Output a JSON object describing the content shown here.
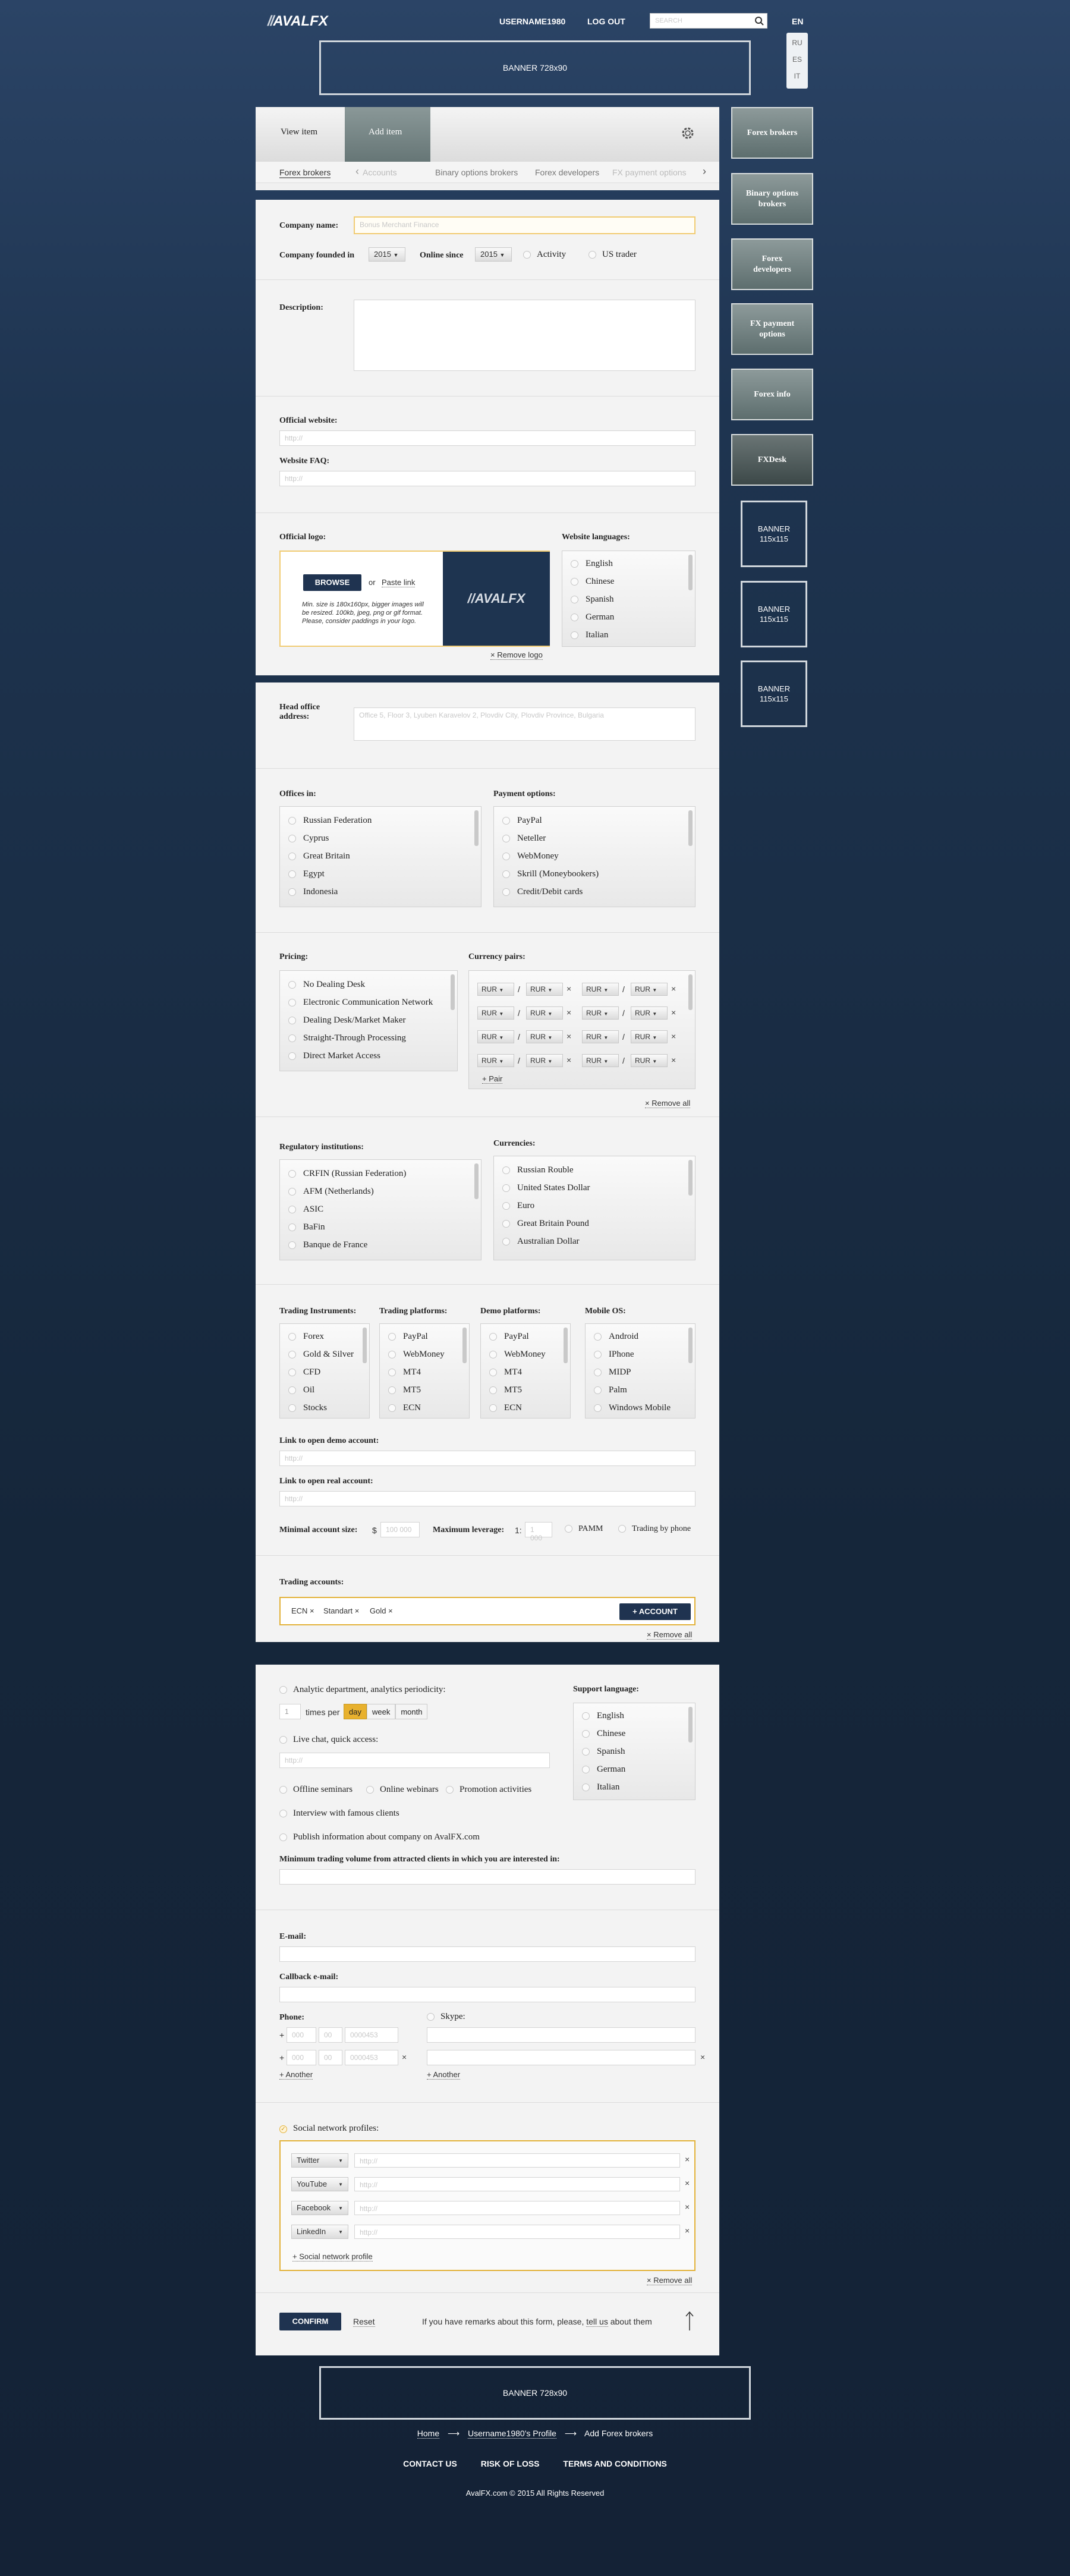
{
  "header": {
    "logo": "AVALFX",
    "username": "USERNAME1980",
    "logout": "LOG OUT",
    "search_placeholder": "SEARCH",
    "lang_current": "EN",
    "lang_options": [
      "RU",
      "ES",
      "IT"
    ]
  },
  "banner_top": "BANNER 728x90",
  "banner_bottom": "BANNER 728x90",
  "tabs": {
    "view": "View item",
    "add": "Add item"
  },
  "categories": [
    "Forex brokers",
    "Accounts",
    "Binary options brokers",
    "Forex developers",
    "FX payment options"
  ],
  "sidebar": {
    "items": [
      "Forex brokers",
      "Binary options brokers",
      "Forex developers",
      "FX payment options",
      "Forex info",
      "FXDesk"
    ],
    "banner": "BANNER 115x115"
  },
  "company": {
    "name_label": "Company name:",
    "name_value": "Bonus Merchant Finance",
    "founded_label": "Company founded in",
    "founded_value": "2015",
    "online_label": "Online since",
    "online_value": "2015",
    "activity": "Activity",
    "us_trader": "US trader"
  },
  "description_label": "Description:",
  "website": {
    "official_label": "Official website:",
    "official_placeholder": "http://",
    "faq_label": "Website FAQ:",
    "faq_placeholder": "http://"
  },
  "logo": {
    "label": "Official logo:",
    "browse": "BROWSE",
    "or": "or",
    "paste": "Paste link",
    "hint": "Min. size is 180x160px, bigger images will be resized. 100kb, jpeg, png or gif format. Please, consider paddings in your logo.",
    "preview": "AVALFX",
    "remove": "× Remove logo"
  },
  "website_languages": {
    "label": "Website languages:",
    "items": [
      "English",
      "Chinese",
      "Spanish",
      "German",
      "Italian"
    ]
  },
  "head_office": {
    "label": "Head office address:",
    "placeholder": "Office 5, Floor 3, Lyuben Karavelov 2, Plovdiv City, Plovdiv Province, Bulgaria"
  },
  "offices": {
    "label": "Offices in:",
    "items": [
      "Russian Federation",
      "Cyprus",
      "Great Britain",
      "Egypt",
      "Indonesia"
    ]
  },
  "payment": {
    "label": "Payment options:",
    "items": [
      "PayPal",
      "Neteller",
      "WebMoney",
      "Skrill (Moneybookers)",
      "Credit/Debit cards"
    ]
  },
  "pricing": {
    "label": "Pricing:",
    "items": [
      "No Dealing Desk",
      "Electronic Communication Network",
      "Dealing Desk/Market Maker",
      "Straight-Through Processing",
      "Direct Market Access"
    ]
  },
  "currency_pairs": {
    "label": "Currency pairs:",
    "value": "RUR",
    "slash": "/",
    "add": "+ Pair",
    "remove": "× Remove all"
  },
  "regulatory": {
    "label": "Regulatory institutions:",
    "items": [
      "CRFIN (Russian Federation)",
      "AFM (Netherlands)",
      "ASIC",
      "BaFin",
      "Banque de France"
    ]
  },
  "currencies": {
    "label": "Currencies:",
    "items": [
      "Russian Rouble",
      "United States Dollar",
      "Euro",
      "Great Britain Pound",
      "Australian Dollar"
    ]
  },
  "instruments": {
    "label": "Trading Instruments:",
    "items": [
      "Forex",
      "Gold & Silver",
      "CFD",
      "Oil",
      "Stocks"
    ]
  },
  "platforms": {
    "label": "Trading platforms:",
    "items": [
      "PayPal",
      "WebMoney",
      "MT4",
      "MT5",
      "ECN"
    ]
  },
  "demo_platforms": {
    "label": "Demo platforms:",
    "items": [
      "PayPal",
      "WebMoney",
      "MT4",
      "MT5",
      "ECN"
    ]
  },
  "mobile": {
    "label": "Mobile OS:",
    "items": [
      "Android",
      "IPhone",
      "MIDP",
      "Palm",
      "Windows Mobile"
    ]
  },
  "demo_link": {
    "label": "Link to open demo account:",
    "placeholder": "http://"
  },
  "real_link": {
    "label": "Link to open real account:",
    "placeholder": "http://"
  },
  "minimal": {
    "label": "Minimal account size:",
    "currency": "$",
    "placeholder": "100 000",
    "leverage_label": "Maximum leverage:",
    "leverage_prefix": "1:",
    "leverage_placeholder": "1 000",
    "pamm": "PAMM",
    "phone": "Trading by phone"
  },
  "accounts": {
    "label": "Trading accounts:",
    "tags": [
      "ECN ×",
      "Standart ×",
      "Gold ×"
    ],
    "add": "+ ACCOUNT",
    "remove": "× Remove all"
  },
  "analytic": {
    "label": "Analytic department, analytics periodicity:",
    "count": "1",
    "times_per": "times per",
    "periods": [
      "day",
      "week",
      "month"
    ],
    "live_label": "Live chat, quick access:",
    "live_placeholder": "http://"
  },
  "checks": [
    "Offline seminars",
    "Online webinars",
    "Promotion activities",
    "Interview with famous clients",
    "Publish information about company on AvalFX.com"
  ],
  "min_volume_label": "Minimum trading volume from attracted clients in which you are interested in:",
  "support_languages": {
    "label": "Support language:",
    "items": [
      "English",
      "Chinese",
      "Spanish",
      "German",
      "Italian"
    ]
  },
  "contacts": {
    "email_label": "E-mail:",
    "callback_label": "Callback e-mail:",
    "phone_label": "Phone:",
    "skype_label": "Skype:",
    "plus": "+",
    "p1": "000",
    "p2": "00",
    "p3": "0000453",
    "another": "+ Another"
  },
  "social": {
    "label": "Social network profiles:",
    "rows": [
      "Twitter",
      "YouTube",
      "Facebook",
      "LinkedIn"
    ],
    "placeholder": "http://",
    "add": "+ Social network profile",
    "remove": "× Remove all"
  },
  "footer_form": {
    "confirm": "CONFIRM",
    "reset": "Reset",
    "remark": "If you have remarks about this form, please,",
    "tell_us": "tell us",
    "remark_end": "about them"
  },
  "breadcrumb": [
    "Home",
    "Username1980's Profile",
    "Add Forex brokers"
  ],
  "footer_links": [
    "CONTACT US",
    "RISK OF LOSS",
    "TERMS AND CONDITIONS"
  ],
  "copyright": "AvalFX.com © 2015 All Rights Reserved",
  "colors": {
    "accent": "#e8b12e",
    "dark_button": "#1f3350",
    "background": "#1e3450"
  }
}
